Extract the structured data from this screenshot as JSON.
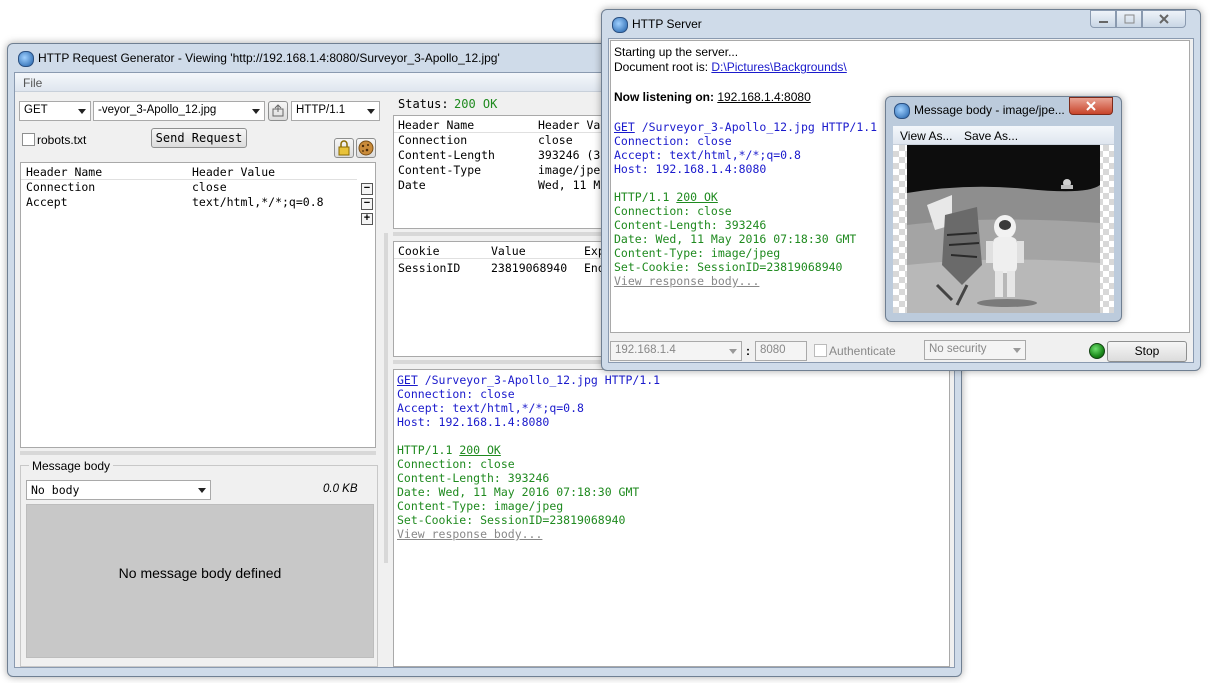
{
  "gen": {
    "title": "HTTP Request Generator - Viewing 'http://192.168.1.4:8080/Surveyor_3-Apollo_12.jpg'",
    "menu_file": "File",
    "method": "GET",
    "url": "-veyor_3-Apollo_12.jpg",
    "version": "HTTP/1.1",
    "robots_label": "robots.txt",
    "send_label": "Send Request",
    "req_headers": {
      "col_name": "Header Name",
      "col_value": "Header Value",
      "rows": [
        {
          "name": "Connection",
          "value": "close"
        },
        {
          "name": "Accept",
          "value": "text/html,*/*;q=0.8"
        }
      ]
    },
    "msgbody": {
      "legend": "Message body",
      "select": "No body",
      "size": "0.0 KB",
      "empty": "No message body defined"
    },
    "status_label": "Status:",
    "status_value": "200 OK",
    "resp_headers": {
      "col_name": "Header Name",
      "col_value": "Header Va",
      "rows": [
        {
          "name": "Connection",
          "value": "close"
        },
        {
          "name": "Content-Length",
          "value": "393246 (3"
        },
        {
          "name": "Content-Type",
          "value": "image/jpe"
        },
        {
          "name": "Date",
          "value": "Wed, 11 M"
        }
      ]
    },
    "cookies": {
      "col_cookie": "Cookie",
      "col_value": "Value",
      "col_exp": "Exp",
      "rows": [
        {
          "cookie": "SessionID",
          "value": "23819068940",
          "exp": "End"
        }
      ]
    },
    "log": {
      "req_method": "GET",
      "req_rest": " /Surveyor_3-Apollo_12.jpg HTTP/1.1",
      "req_lines": [
        "Connection: close",
        "Accept: text/html,*/*;q=0.8",
        "Host: 192.168.1.4:8080"
      ],
      "resp_version": "HTTP/1.1 ",
      "resp_status": "200 OK",
      "resp_lines": [
        "Connection: close",
        "Content-Length: 393246",
        "Date: Wed, 11 May 2016 07:18:30 GMT",
        "Content-Type: image/jpeg",
        "Set-Cookie: SessionID=23819068940"
      ],
      "view_link": "View response body..."
    }
  },
  "server": {
    "title": "HTTP Server",
    "line1": "Starting up the server...",
    "docroot_label": "Document root is: ",
    "docroot_link": "D:\\Pictures\\Backgrounds\\",
    "listening_label": "Now listening on: ",
    "listening_addr": "192.168.1.4:8080",
    "log": {
      "req_method": "GET",
      "req_rest": " /Surveyor_3-Apollo_12.jpg HTTP/1.1",
      "req_lines": [
        "Connection: close",
        "Accept: text/html,*/*;q=0.8",
        "Host: 192.168.1.4:8080"
      ],
      "resp_version": "HTTP/1.1 ",
      "resp_status": "200 OK",
      "resp_lines": [
        "Connection: close",
        "Content-Length: 393246",
        "Date: Wed, 11 May 2016 07:18:30 GMT",
        "Content-Type: image/jpeg",
        "Set-Cookie: SessionID=23819068940"
      ],
      "view_link": "View response body..."
    },
    "ip": "192.168.1.4",
    "colon": ":",
    "port": "8080",
    "auth_label": "Authenticate",
    "security": "No security",
    "stop_label": "Stop"
  },
  "msgwin": {
    "title": "Message body - image/jpe...",
    "menu_view": "View As...",
    "menu_save": "Save As..."
  },
  "colors": {
    "request_text": "#1a1acc",
    "response_text": "#1f8a1f",
    "status_ok": "#1f8a1f",
    "indicator": "#1c8a1c"
  }
}
